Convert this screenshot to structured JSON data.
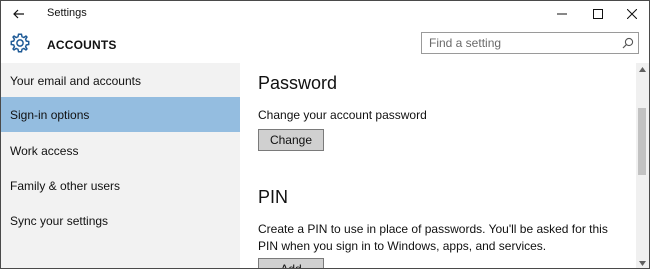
{
  "window": {
    "title": "Settings"
  },
  "header": {
    "section_title": "ACCOUNTS",
    "search_placeholder": "Find a setting"
  },
  "sidebar": {
    "items": [
      {
        "label": "Your email and accounts",
        "selected": false
      },
      {
        "label": "Sign-in options",
        "selected": true
      },
      {
        "label": "Work access",
        "selected": false
      },
      {
        "label": "Family & other users",
        "selected": false
      },
      {
        "label": "Sync your settings",
        "selected": false
      }
    ]
  },
  "main": {
    "password": {
      "heading": "Password",
      "description": "Change your account password",
      "button": "Change"
    },
    "pin": {
      "heading": "PIN",
      "description_line1": "Create a PIN to use in place of passwords. You'll be asked for this",
      "description_line2": "PIN when you sign in to Windows, apps, and services.",
      "button": "Add"
    }
  },
  "colors": {
    "selected_nav": "#94bde0",
    "sidebar_bg": "#f2f2f2",
    "accent_icon": "#1e5a96"
  }
}
